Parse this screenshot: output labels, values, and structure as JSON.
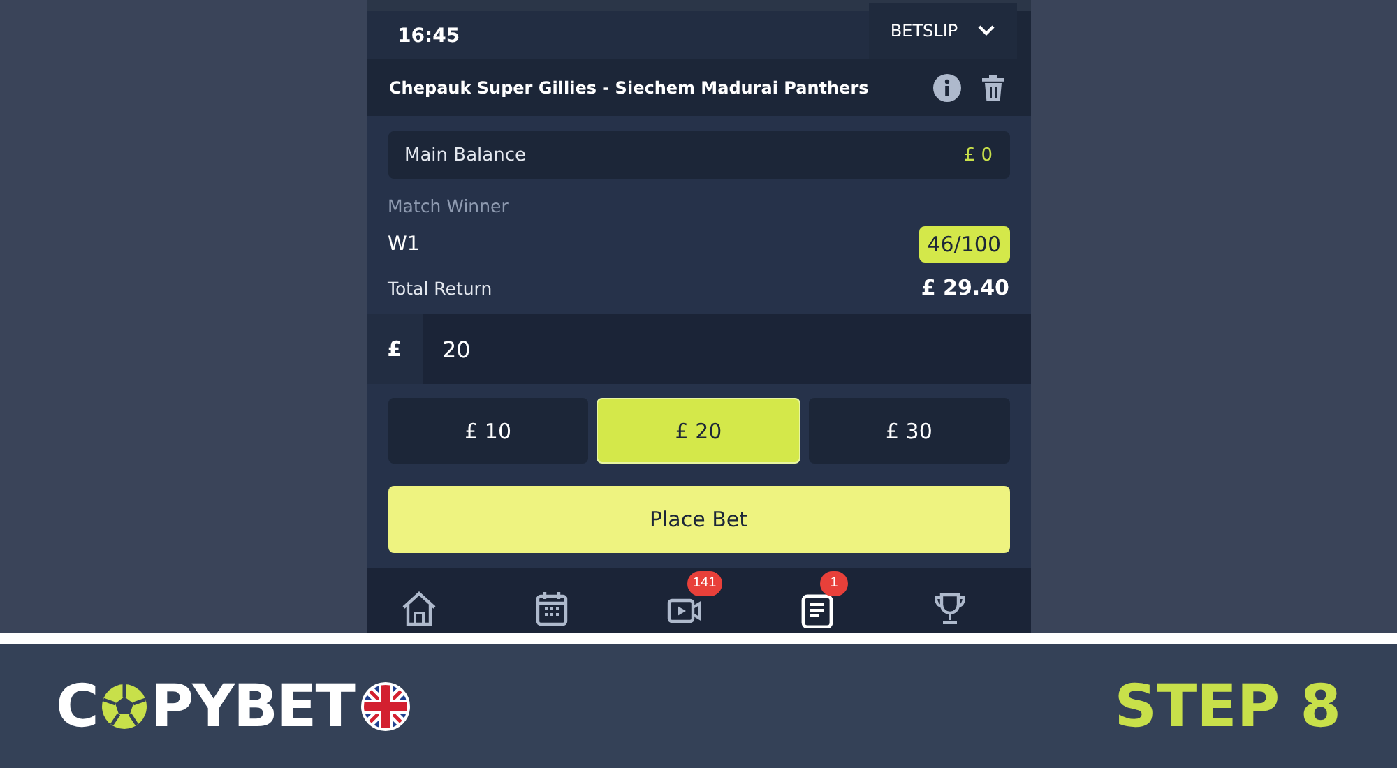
{
  "betslip": {
    "time": "16:45",
    "tab_label": "BETSLIP",
    "event": "Chepauk Super Gillies - Siechem Madurai Panthers",
    "balance": {
      "label": "Main Balance",
      "value": "£ 0"
    },
    "market": "Match Winner",
    "selection": "W1",
    "odds": "46/100",
    "total_return": {
      "label": "Total Return",
      "value": "£ 29.40"
    },
    "stake": {
      "currency": "£",
      "value": "20"
    },
    "quick_stakes": [
      {
        "label": "£ 10",
        "selected": false
      },
      {
        "label": "£ 20",
        "selected": true
      },
      {
        "label": "£ 30",
        "selected": false
      }
    ],
    "place_button": "Place Bet"
  },
  "nav": [
    {
      "kind": "home"
    },
    {
      "kind": "calendar"
    },
    {
      "kind": "video",
      "badge": "141"
    },
    {
      "kind": "betslip",
      "badge": "1"
    },
    {
      "kind": "trophy"
    }
  ],
  "banner": {
    "logo_start": "C",
    "logo_end": "PYBET",
    "step": "STEP 8"
  }
}
